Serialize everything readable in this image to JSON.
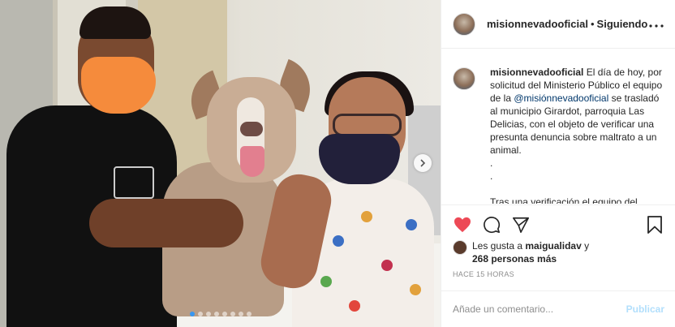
{
  "header": {
    "username": "misionnevadooficial",
    "separator": "•",
    "follow_status": "Siguiendo",
    "more_icon": "more-horizontal-icon"
  },
  "caption": {
    "username": "misionnevadooficial",
    "text_1": " El día de hoy, por solicitud del Ministerio Público el equipo de la ",
    "mention": "@misiónnevadooficial",
    "text_2": " se trasladó al municipio Girardot, parroquia Las Delicias, con el objeto de verificar una presunta denuncia sobre maltrato a un animal.\n.\n.\n\nTras una verificación el equipo del"
  },
  "actions": {
    "like_icon": "heart-filled-icon",
    "comment_icon": "comment-icon",
    "share_icon": "send-icon",
    "save_icon": "bookmark-icon",
    "like_color": "#ed4956"
  },
  "likes": {
    "prefix": "Les gusta a ",
    "user": "maigualidav",
    "conjunction": " y",
    "others": "268 personas más"
  },
  "timestamp": "HACE 15 HORAS",
  "comment": {
    "placeholder": "Añade un comentario...",
    "publish_label": "Publicar"
  },
  "carousel": {
    "total_slides": 8,
    "active_index": 0,
    "next_icon": "chevron-right-icon"
  },
  "colors": {
    "accent": "#3897f0",
    "publish_disabled": "#b2dffc",
    "mention": "#00376b"
  }
}
